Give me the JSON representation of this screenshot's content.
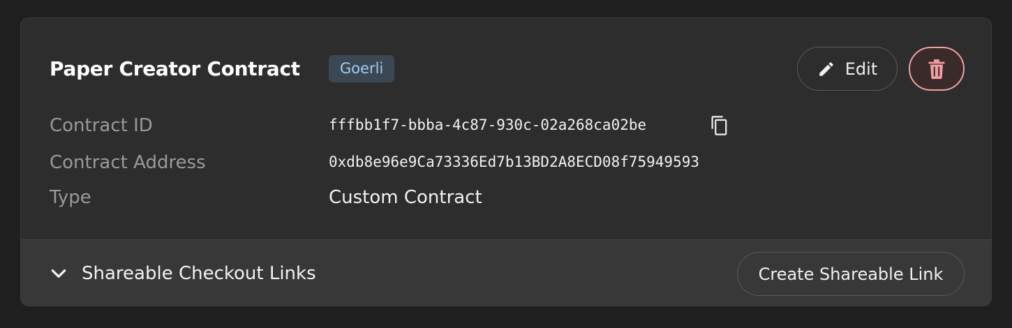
{
  "card": {
    "title": "Paper Creator Contract",
    "network_badge": "Goerli",
    "edit_label": "Edit",
    "delete_icon": "trash-icon",
    "edit_icon": "pencil-icon"
  },
  "details": {
    "contract_id": {
      "label": "Contract ID",
      "value": "fffbb1f7-bbba-4c87-930c-02a268ca02be",
      "copy_icon": "copy-icon"
    },
    "contract_address": {
      "label": "Contract Address",
      "value": "0xdb8e96e9Ca73336Ed7b13BD2A8ECD08f75949593"
    },
    "type": {
      "label": "Type",
      "value": "Custom Contract"
    }
  },
  "footer": {
    "toggle_label": "Shareable Checkout Links",
    "toggle_icon": "chevron-down-icon",
    "create_button_label": "Create Shareable Link"
  },
  "colors": {
    "background": "#1f1f1f",
    "card": "#2d2d2d",
    "footer": "#383838",
    "badge_bg": "#3b4854",
    "badge_text": "#9fcbf0",
    "danger": "#f4a0a0"
  }
}
